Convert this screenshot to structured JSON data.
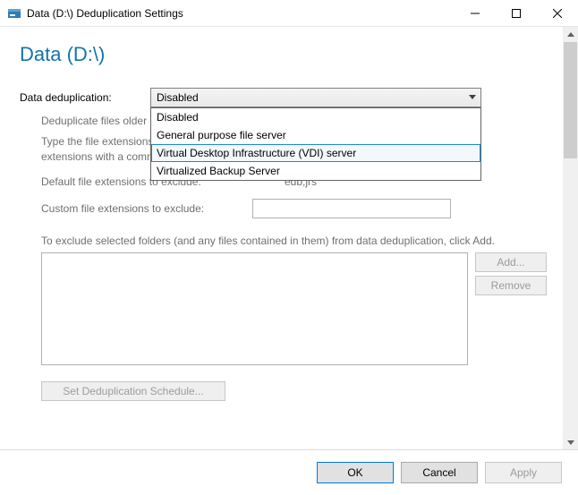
{
  "window": {
    "title": "Data (D:\\) Deduplication Settings"
  },
  "page": {
    "heading": "Data (D:\\)",
    "dedup_label": "Data deduplication:",
    "dedup_selected": "Disabled",
    "dedup_options": {
      "o0": "Disabled",
      "o1": "General purpose file server",
      "o2": "Virtual Desktop Infrastructure (VDI) server",
      "o3": "Virtualized Backup Server"
    },
    "dedup_older_label": "Deduplicate files older",
    "type_ext_desc_line1": "Type the file extensions",
    "type_ext_desc_line2": "extensions with a comma",
    "default_ext_label": "Default file extensions to exclude:",
    "default_ext_value": "edb,jrs",
    "custom_ext_label": "Custom file extensions to exclude:",
    "custom_ext_value": "",
    "folder_desc": "To exclude selected folders (and any files contained in them) from data deduplication, click Add.",
    "btn_add": "Add...",
    "btn_remove": "Remove",
    "btn_schedule": "Set Deduplication Schedule..."
  },
  "footer": {
    "ok": "OK",
    "cancel": "Cancel",
    "apply": "Apply"
  },
  "icons": {
    "app": "server-manager-icon",
    "min": "minimize-icon",
    "max": "maximize-icon",
    "close": "close-icon",
    "chevron": "chevron-down-icon",
    "sb_up": "scrollbar-up-icon",
    "sb_down": "scrollbar-down-icon"
  }
}
